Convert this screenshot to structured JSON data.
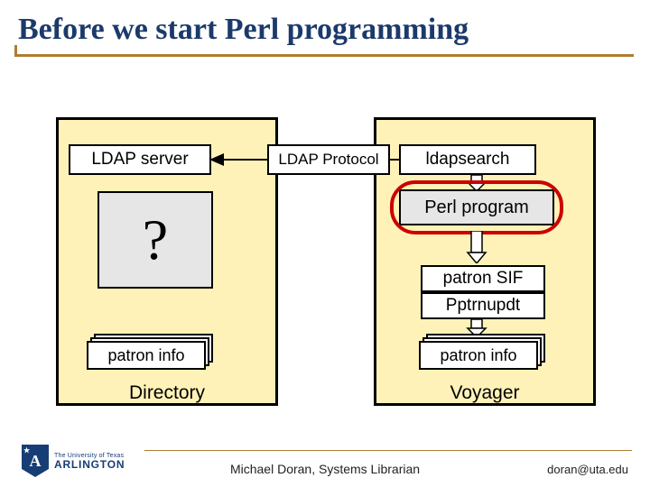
{
  "title": "Before we start Perl programming",
  "left_panel": {
    "ldap_server": "LDAP server",
    "question": "?",
    "patron_info": "patron info",
    "system": "Directory"
  },
  "protocol_label": "LDAP Protocol",
  "right_panel": {
    "ldapsearch": "ldapsearch",
    "perl_program": "Perl program",
    "patron_sif": "patron SIF",
    "pptrnupdt": "Pptrnupdt",
    "patron_info": "patron info",
    "system": "Voyager"
  },
  "footer": {
    "center": "Michael Doran, Systems Librarian",
    "email": "doran@uta.edu",
    "logo_letter": "A",
    "logo_uni": "The University of Texas",
    "logo_arl": "ARLINGTON"
  },
  "colors": {
    "title": "#1b3a6b",
    "accent": "#b07c32",
    "panel_bg": "#fff2b8",
    "highlight_ring": "#cc0000"
  }
}
